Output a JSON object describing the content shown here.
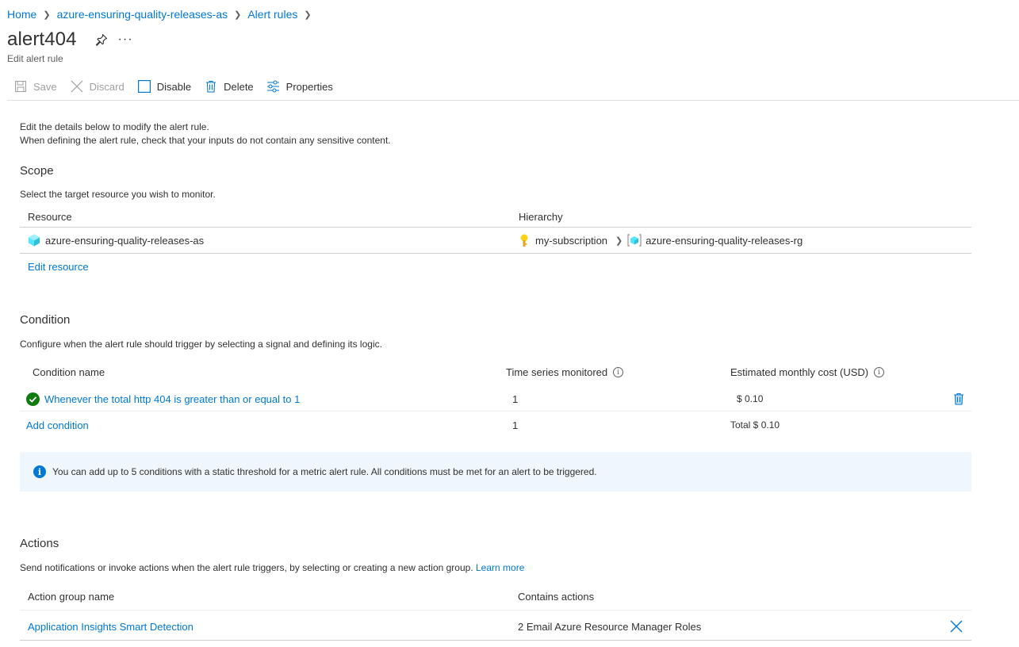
{
  "breadcrumb": [
    {
      "label": "Home"
    },
    {
      "label": "azure-ensuring-quality-releases-as"
    },
    {
      "label": "Alert rules"
    }
  ],
  "page": {
    "title": "alert404",
    "subtitle": "Edit alert rule",
    "more_label": "···"
  },
  "toolbar": {
    "save": "Save",
    "discard": "Discard",
    "disable": "Disable",
    "delete": "Delete",
    "properties": "Properties"
  },
  "intro": {
    "line1": "Edit the details below to modify the alert rule.",
    "line2": "When defining the alert rule, check that your inputs do not contain any sensitive content."
  },
  "scope": {
    "title": "Scope",
    "description": "Select the target resource you wish to monitor.",
    "col_resource": "Resource",
    "col_hierarchy": "Hierarchy",
    "resource_name": "azure-ensuring-quality-releases-as",
    "subscription": "my-subscription",
    "resource_group": "azure-ensuring-quality-releases-rg",
    "edit_link": "Edit resource"
  },
  "condition": {
    "title": "Condition",
    "description": "Configure when the alert rule should trigger by selecting a signal and defining its logic.",
    "col_name": "Condition name",
    "col_series": "Time series monitored",
    "col_cost": "Estimated monthly cost (USD)",
    "row_name": "Whenever the total http 404 is greater than or equal to 1",
    "row_series": "1",
    "row_cost": "$ 0.10",
    "add_link": "Add condition",
    "total_series": "1",
    "total_cost": "Total $ 0.10",
    "info_text": "You can add up to 5 conditions with a static threshold for a metric alert rule. All conditions must be met for an alert to be triggered."
  },
  "actions": {
    "title": "Actions",
    "description": "Send notifications or invoke actions when the alert rule triggers, by selecting or creating a new action group.",
    "learn_more": "Learn more",
    "col_group": "Action group name",
    "col_contains": "Contains actions",
    "group_name": "Application Insights Smart Detection",
    "group_contains": "2 Email Azure Resource Manager Roles"
  },
  "colors": {
    "link": "#0078d4",
    "success": "#107c10",
    "info_bg": "#eff6fc",
    "key": "#fcd116"
  }
}
